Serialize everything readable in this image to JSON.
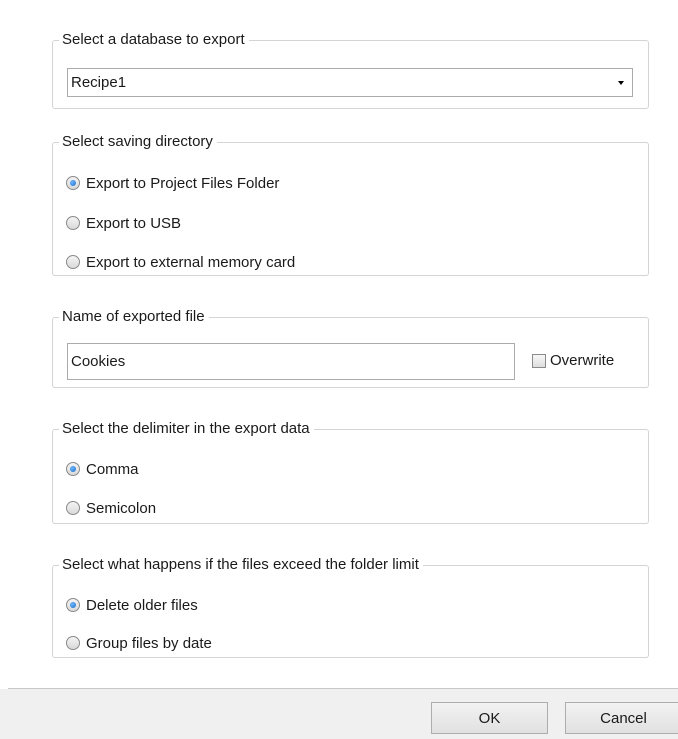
{
  "database_group": {
    "legend": "Select a database to export",
    "selected": "Recipe1"
  },
  "directory_group": {
    "legend": "Select saving directory",
    "options": [
      {
        "label": "Export to Project Files Folder",
        "checked": true
      },
      {
        "label": "Export to USB",
        "checked": false
      },
      {
        "label": "Export to external memory card",
        "checked": false
      }
    ]
  },
  "filename_group": {
    "legend": "Name of exported file",
    "value": "Cookies",
    "overwrite_label": "Overwrite",
    "overwrite_checked": false
  },
  "delimiter_group": {
    "legend": "Select the delimiter in the export data",
    "options": [
      {
        "label": "Comma",
        "checked": true
      },
      {
        "label": "Semicolon",
        "checked": false
      }
    ]
  },
  "limit_group": {
    "legend": "Select what happens if the files exceed the folder limit",
    "options": [
      {
        "label": "Delete older files",
        "checked": true
      },
      {
        "label": "Group files by date",
        "checked": false
      }
    ]
  },
  "buttons": {
    "ok": "OK",
    "cancel": "Cancel"
  },
  "colors": {
    "radio_selected": "#1a6fc9",
    "group_border": "#d4d4d4",
    "footer_bg": "#f0f0f0"
  }
}
